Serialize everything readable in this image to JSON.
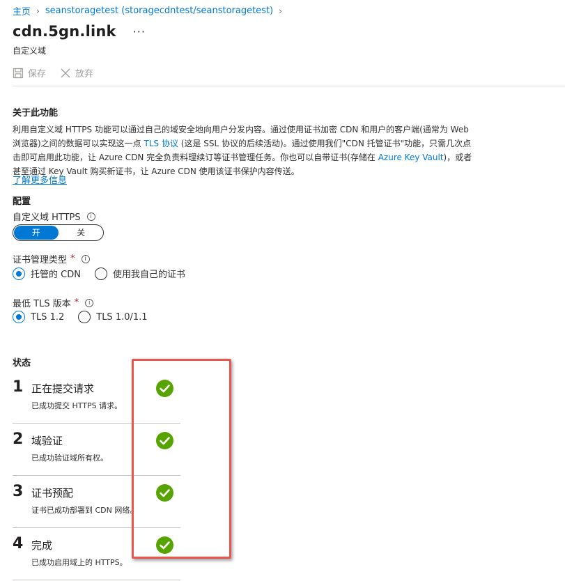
{
  "breadcrumb": {
    "home": "主页",
    "parent": "seanstoragetest (storagecdntest/seanstoragetest)"
  },
  "header": {
    "title": "cdn.5gn.link",
    "more": "···",
    "subtitle": "自定义域"
  },
  "toolbar": {
    "save_label": "保存",
    "discard_label": "放弃"
  },
  "about": {
    "heading": "关于此功能",
    "text1": "利用自定义域 HTTPS 功能可以通过自己的域安全地向用户分发内容。通过使用证书加密 CDN 和用户的客户端(通常为 Web 浏览器)之间的数据可以实现这一点 ",
    "tls_link": "TLS 协议",
    "text2": " (这是 SSL 协议的后续活动)。通过使用我们\"CDN 托管证书\"功能，只需几次点击即可启用此功能，让 Azure CDN 完全负责料理续订等证书管理任务。你也可以自带证书(存储在 ",
    "kv_link": "Azure Key Vault",
    "text3": ")，或者甚至通过 Key Vault 购买新证书，让 Azure CDN 使用该证书保护内容传送。",
    "learn_more": "了解更多信息"
  },
  "config": {
    "heading": "配置",
    "https_label": "自定义域 HTTPS",
    "toggle_on": "开",
    "toggle_off": "关",
    "cert_type_label": "证书管理类型",
    "cert_options": [
      "托管的 CDN",
      "使用我自己的证书"
    ],
    "tls_label": "最低 TLS 版本",
    "tls_options": [
      "TLS 1.2",
      "TLS 1.0/1.1"
    ],
    "required_mark": "*",
    "info_glyph": "i"
  },
  "status": {
    "heading": "状态",
    "steps": [
      {
        "num": "1",
        "title": "正在提交请求",
        "desc": "已成功提交 HTTPS 请求。"
      },
      {
        "num": "2",
        "title": "域验证",
        "desc": "已成功验证域所有权。"
      },
      {
        "num": "3",
        "title": "证书预配",
        "desc": "证书已成功部署到 CDN 网络。"
      },
      {
        "num": "4",
        "title": "完成",
        "desc": "已成功启用域上的 HTTPS。"
      }
    ]
  },
  "colors": {
    "accent": "#0078d4",
    "success": "#57a300",
    "highlight": "#e8564e",
    "required": "#a4262c"
  }
}
